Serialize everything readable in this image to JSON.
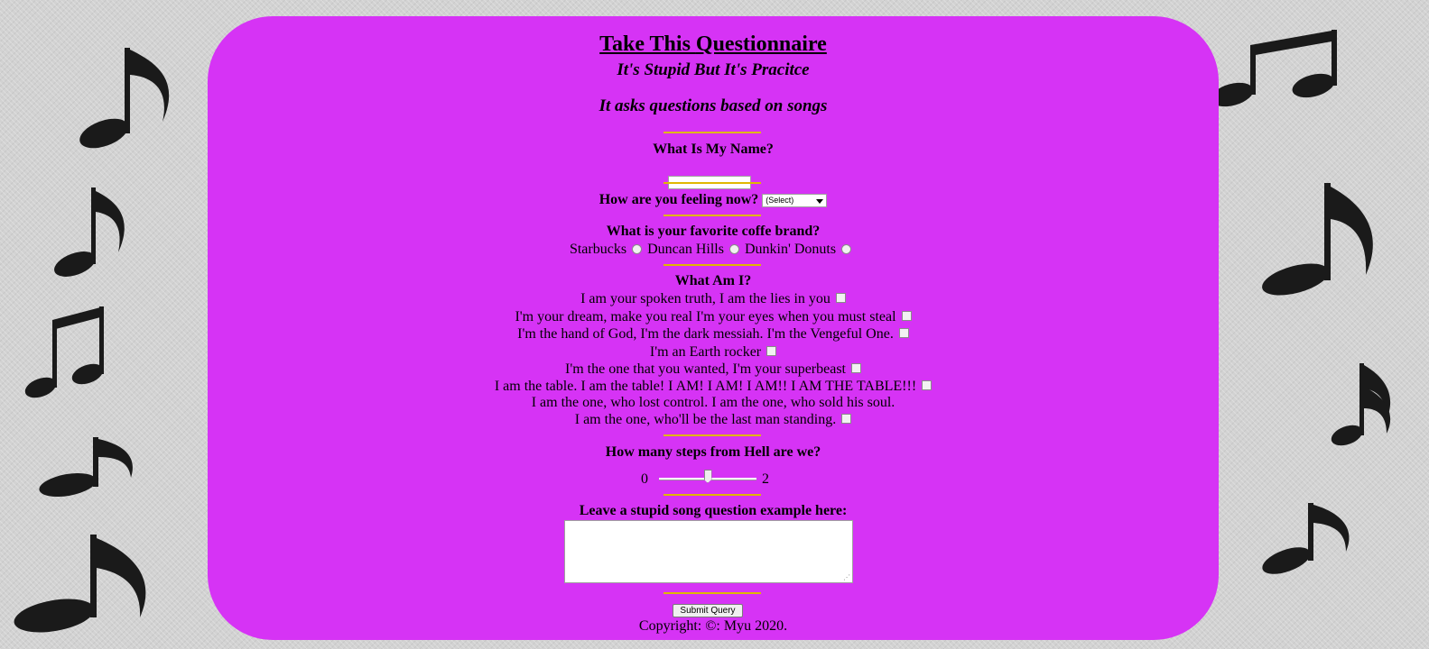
{
  "page": {
    "title_part1": "Take This ",
    "title_part2": "Questionnaire",
    "subtitle1": "It's Stupid But It's Pracitce",
    "subtitle2": "It asks questions based on songs"
  },
  "questions": {
    "name": {
      "label": "What Is My Name?",
      "value": ""
    },
    "feeling": {
      "label": "How are you feeling now?",
      "selected": "(Select)"
    },
    "coffee": {
      "label": "What is your favorite coffe brand?",
      "options": [
        "Starbucks",
        "Duncan Hills",
        "Dunkin' Donuts"
      ]
    },
    "what_am_i": {
      "label": "What Am I?",
      "options": [
        {
          "text": "I am your spoken truth, I am the lies in you",
          "has_checkbox": true
        },
        {
          "text": "I'm your dream, make you real I'm your eyes when you must steal",
          "has_checkbox": true
        },
        {
          "text": "I'm the hand of God, I'm the dark messiah. I'm the Vengeful One.",
          "has_checkbox": true
        },
        {
          "text": "I'm an Earth rocker",
          "has_checkbox": true
        },
        {
          "text": "I'm the one that you wanted, I'm your superbeast",
          "has_checkbox": true
        },
        {
          "text": "I am the table. I am the table! I AM! I AM! I AM!! I AM THE TABLE!!!",
          "has_checkbox": true
        },
        {
          "text": "I am the one, who lost control. I am the one, who sold his soul.",
          "has_checkbox": false
        },
        {
          "text": "I am the one, who'll be the last man standing.",
          "has_checkbox": true
        }
      ]
    },
    "steps": {
      "label": "How many steps from Hell are we?",
      "min": "0",
      "max": "2",
      "value": 1
    },
    "comment": {
      "label": "Leave a stupid song question example here:",
      "value": ""
    }
  },
  "submit_label": "Submit Query",
  "footer": "Copyright: ©: Myu 2020.",
  "colors": {
    "panel": "#d633f5",
    "separator": "#e0b800",
    "background": "#d2d2d2"
  }
}
